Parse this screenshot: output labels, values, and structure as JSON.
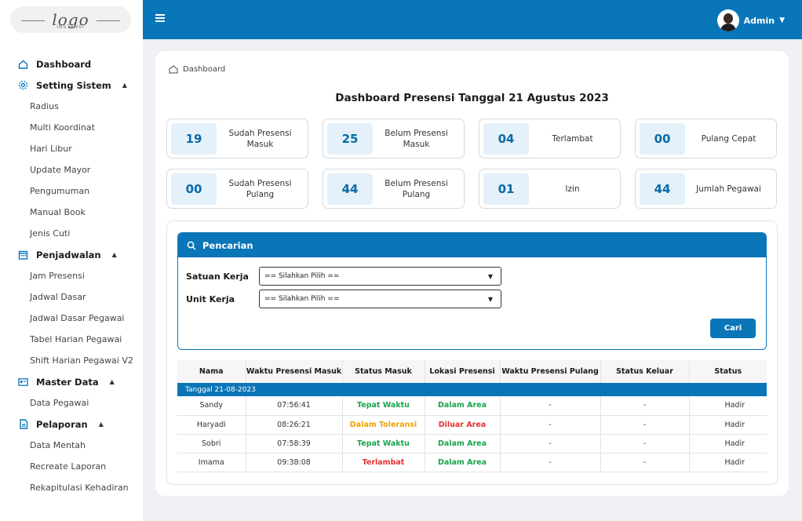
{
  "logo": {
    "text": "logo",
    "sub": "INSTANSI"
  },
  "sidebar": {
    "groups": [
      {
        "label": "Dashboard",
        "icon": "home-icon",
        "items": []
      },
      {
        "label": "Setting Sistem",
        "icon": "gear-icon",
        "items": [
          "Radius",
          "Multi Koordinat",
          "Hari Libur",
          "Update Mayor",
          "Pengumuman",
          "Manual Book",
          "Jenis Cuti"
        ]
      },
      {
        "label": "Penjadwalan",
        "icon": "calendar-icon",
        "items": [
          "Jam Presensi",
          "Jadwal Dasar",
          "Jadwal Dasar Pegawai",
          "Tabel Harian Pegawai",
          "Shift Harian Pegawai V2"
        ]
      },
      {
        "label": "Master Data",
        "icon": "id-card-icon",
        "items": [
          "Data Pegawai"
        ]
      },
      {
        "label": "Pelaporan",
        "icon": "document-icon",
        "items": [
          "Data Mentah",
          "Recreate Laporan",
          "Rekapitulasi Kehadiran"
        ]
      }
    ]
  },
  "topbar": {
    "user": "Admin"
  },
  "breadcrumb": "Dashboard",
  "title": "Dashboard Presensi Tanggal 21 Agustus 2023",
  "stats": [
    {
      "value": "19",
      "label": "Sudah Presensi Masuk"
    },
    {
      "value": "25",
      "label": "Belum Presensi Masuk"
    },
    {
      "value": "04",
      "label": "Terlambat"
    },
    {
      "value": "00",
      "label": "Pulang Cepat"
    },
    {
      "value": "00",
      "label": "Sudah Presensi Pulang"
    },
    {
      "value": "44",
      "label": "Belum Presensi Pulang"
    },
    {
      "value": "01",
      "label": "Izin"
    },
    {
      "value": "44",
      "label": "Jumlah Pegawai"
    }
  ],
  "search": {
    "title": "Pencarian",
    "satuan_label": "Satuan Kerja",
    "satuan_value": "== Silahkan Pilih ==",
    "unit_label": "Unit Kerja",
    "unit_value": "== Silahkan Pilih ==",
    "button": "Cari"
  },
  "table": {
    "headers": [
      "Nama",
      "Waktu Presensi Masuk",
      "Status Masuk",
      "Lokasi Presensi",
      "Waktu Presensi Pulang",
      "Status Keluar",
      "Status"
    ],
    "group": "Tanggal 21-08-2023",
    "rows": [
      {
        "nama": "Sandy",
        "masuk": "07:56:41",
        "status_masuk": "Tepat Waktu",
        "lokasi": "Dalam Area",
        "pulang": "-",
        "keluar": "-",
        "status": "Hadir"
      },
      {
        "nama": "Haryadi",
        "masuk": "08:26:21",
        "status_masuk": "Dalam Toleransi",
        "lokasi": "Diluar Area",
        "pulang": "-",
        "keluar": "-",
        "status": "Hadir"
      },
      {
        "nama": "Sobri",
        "masuk": "07:58:39",
        "status_masuk": "Tepat Waktu",
        "lokasi": "Dalam Area",
        "pulang": "-",
        "keluar": "-",
        "status": "Hadir"
      },
      {
        "nama": "Imama",
        "masuk": "09:38:08",
        "status_masuk": "Terlambat",
        "lokasi": "Dalam Area",
        "pulang": "-",
        "keluar": "-",
        "status": "Hadir"
      }
    ]
  }
}
